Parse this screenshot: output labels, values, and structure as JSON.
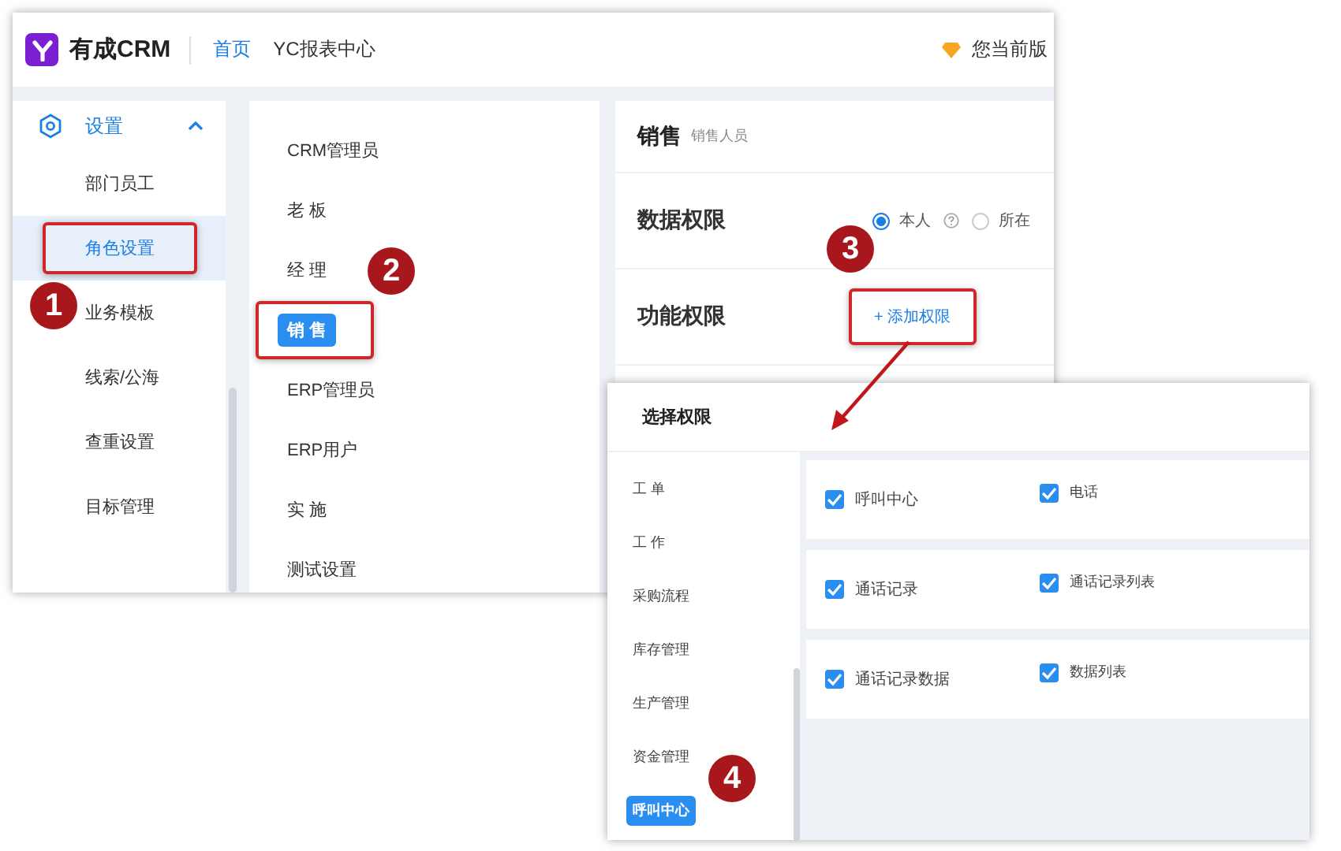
{
  "app": {
    "logo_text": "有成CRM",
    "nav": [
      {
        "label": "首页",
        "selected": true
      },
      {
        "label": "YC报表中心",
        "selected": false
      }
    ],
    "version_notice": "您当前版"
  },
  "sidebar": {
    "group": {
      "label": "设置",
      "expanded": true,
      "items": [
        {
          "label": "部门员工",
          "selected": false
        },
        {
          "label": "角色设置",
          "selected": true
        },
        {
          "label": "业务模板",
          "selected": false
        },
        {
          "label": "线索/公海",
          "selected": false
        },
        {
          "label": "查重设置",
          "selected": false
        },
        {
          "label": "目标管理",
          "selected": false
        }
      ]
    }
  },
  "roles": [
    {
      "label": "CRM管理员",
      "selected": false
    },
    {
      "label": "老 板",
      "selected": false
    },
    {
      "label": "经 理",
      "selected": false
    },
    {
      "label": "销 售",
      "selected": true
    },
    {
      "label": "ERP管理员",
      "selected": false
    },
    {
      "label": "ERP用户",
      "selected": false
    },
    {
      "label": "实 施",
      "selected": false
    },
    {
      "label": "测试设置",
      "selected": false
    }
  ],
  "role_detail": {
    "title": "销售",
    "subtitle": "销售人员",
    "data_permission": {
      "label": "数据权限",
      "options": [
        {
          "label": "本人",
          "selected": true
        },
        {
          "label": "所在",
          "selected": false
        }
      ]
    },
    "function_permission": {
      "label": "功能权限",
      "add_button": "+ 添加权限"
    }
  },
  "dialog": {
    "title": "选择权限",
    "modules": [
      {
        "label": "工 单",
        "selected": false
      },
      {
        "label": "工 作",
        "selected": false
      },
      {
        "label": "采购流程",
        "selected": false
      },
      {
        "label": "库存管理",
        "selected": false
      },
      {
        "label": "生产管理",
        "selected": false
      },
      {
        "label": "资金管理",
        "selected": false
      },
      {
        "label": "呼叫中心",
        "selected": true
      }
    ],
    "groups": [
      {
        "label": "呼叫中心",
        "checked": true,
        "children": [
          {
            "label": "电话",
            "checked": true
          }
        ]
      },
      {
        "label": "通话记录",
        "checked": true,
        "children": [
          {
            "label": "通话记录列表",
            "checked": true
          }
        ]
      },
      {
        "label": "通话记录数据",
        "checked": true,
        "children": [
          {
            "label": "数据列表",
            "checked": true
          }
        ]
      }
    ]
  },
  "annotations": [
    {
      "number": "1"
    },
    {
      "number": "2"
    },
    {
      "number": "3"
    },
    {
      "number": "4"
    }
  ]
}
